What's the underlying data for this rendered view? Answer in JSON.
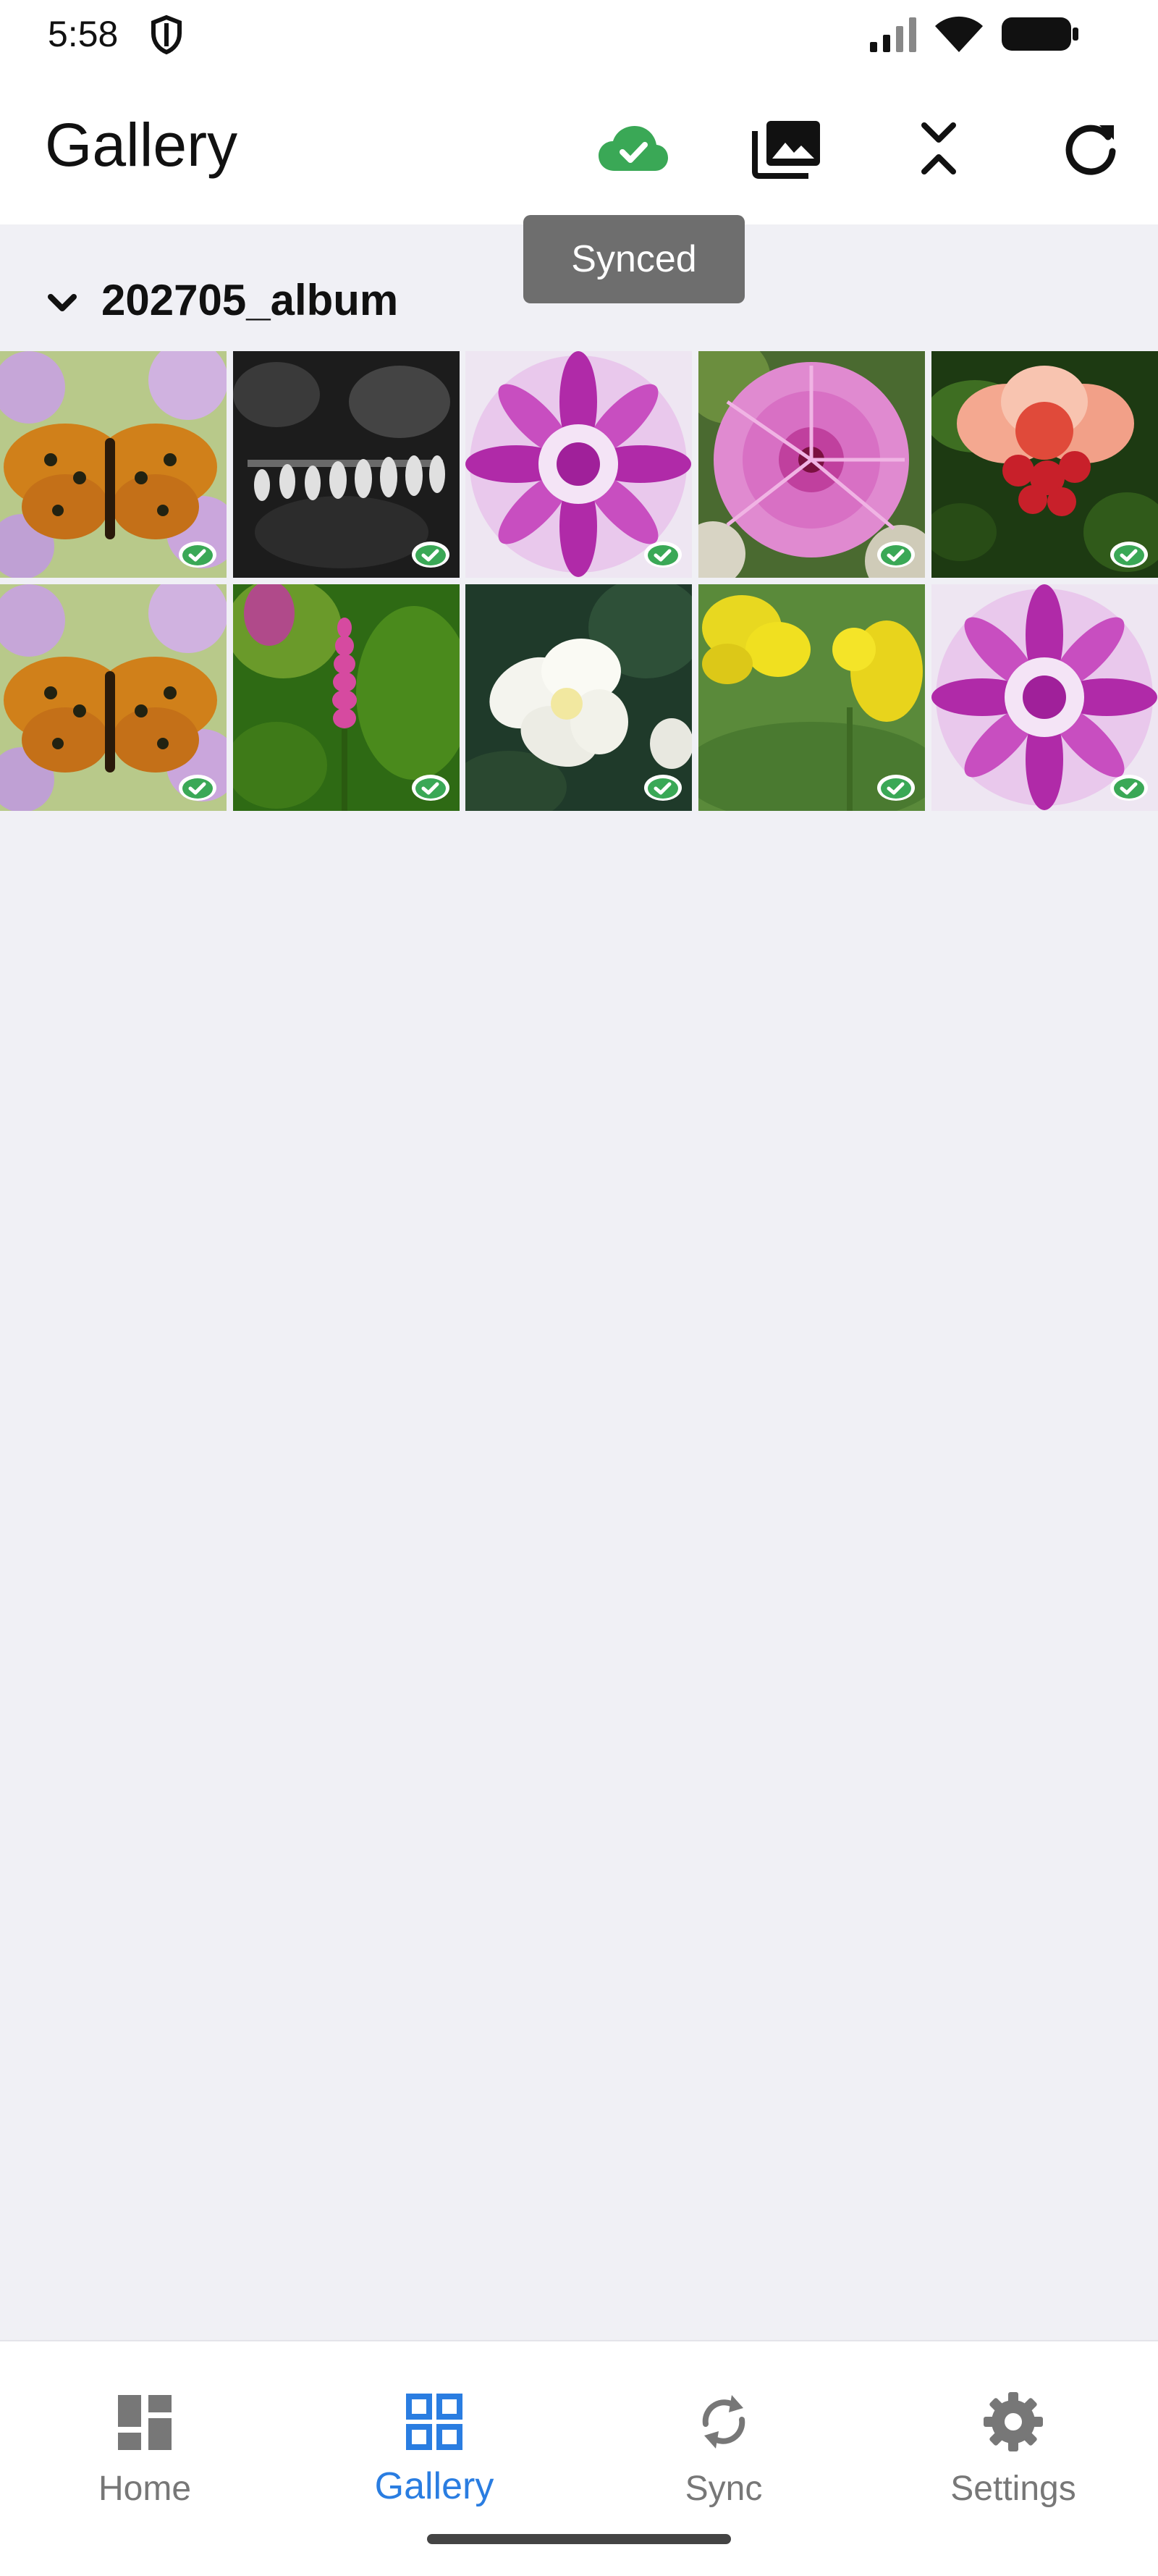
{
  "status_bar": {
    "time": "5:58"
  },
  "app_bar": {
    "title": "Gallery",
    "actions": [
      {
        "name": "cloud-synced-icon",
        "color": "#3aa856"
      },
      {
        "name": "photo-library-icon"
      },
      {
        "name": "collapse-icon"
      },
      {
        "name": "refresh-icon"
      }
    ]
  },
  "tooltip": {
    "text": "Synced"
  },
  "album": {
    "title": "202705_album",
    "photos": [
      {
        "subject": "butterfly",
        "synced": true
      },
      {
        "subject": "black-and-white flowers",
        "synced": true
      },
      {
        "subject": "purple dahlia",
        "synced": true
      },
      {
        "subject": "pink morning glory",
        "synced": true
      },
      {
        "subject": "red flower",
        "synced": true
      },
      {
        "subject": "butterfly",
        "synced": true
      },
      {
        "subject": "pink flower spike",
        "synced": true
      },
      {
        "subject": "white narcissus",
        "synced": true
      },
      {
        "subject": "yellow flowers",
        "synced": true
      },
      {
        "subject": "purple dahlia",
        "synced": true
      }
    ]
  },
  "bottom_nav": {
    "items": [
      {
        "label": "Home",
        "icon": "dashboard-icon",
        "active": false
      },
      {
        "label": "Gallery",
        "icon": "grid-icon",
        "active": true
      },
      {
        "label": "Sync",
        "icon": "sync-icon",
        "active": false
      },
      {
        "label": "Settings",
        "icon": "gear-icon",
        "active": false
      }
    ]
  },
  "colors": {
    "accent": "#2a7de1",
    "synced_green": "#3aa856",
    "background": "#f0f0f5"
  }
}
